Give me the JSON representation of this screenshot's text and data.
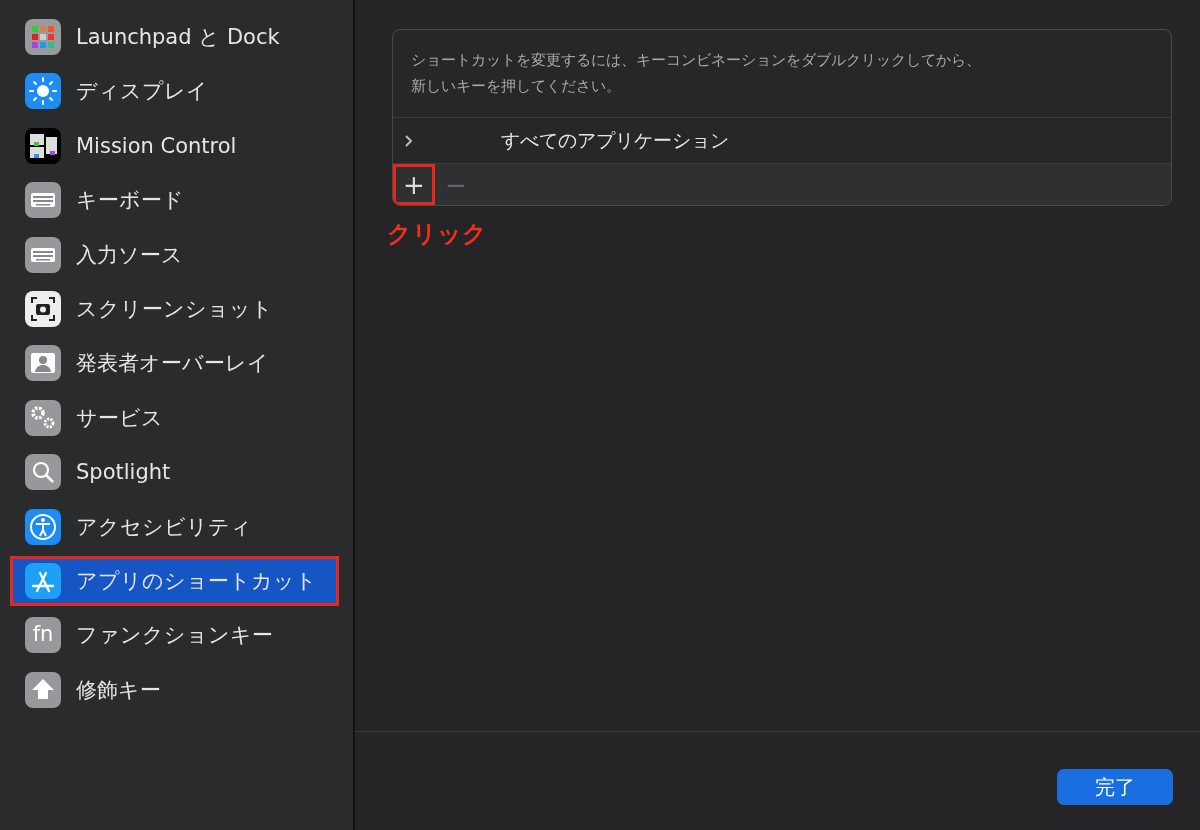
{
  "sidebar": {
    "items": [
      {
        "label": "Launchpad と Dock",
        "kind": "launchpad",
        "selected": false,
        "annotated": false
      },
      {
        "label": "ディスプレイ",
        "kind": "display",
        "selected": false,
        "annotated": false
      },
      {
        "label": "Mission Control",
        "kind": "mission",
        "selected": false,
        "annotated": false
      },
      {
        "label": "キーボード",
        "kind": "keyboard",
        "selected": false,
        "annotated": false
      },
      {
        "label": "入力ソース",
        "kind": "keyboard",
        "selected": false,
        "annotated": false
      },
      {
        "label": "スクリーンショット",
        "kind": "screenshot",
        "selected": false,
        "annotated": false
      },
      {
        "label": "発表者オーバーレイ",
        "kind": "person",
        "selected": false,
        "annotated": false
      },
      {
        "label": "サービス",
        "kind": "gears",
        "selected": false,
        "annotated": false
      },
      {
        "label": "Spotlight",
        "kind": "search",
        "selected": false,
        "annotated": false
      },
      {
        "label": "アクセシビリティ",
        "kind": "accessibility",
        "selected": false,
        "annotated": false
      },
      {
        "label": "アプリのショートカット",
        "kind": "appstore",
        "selected": true,
        "annotated": true
      },
      {
        "label": "ファンクションキー",
        "kind": "fn",
        "icon_text": "fn",
        "selected": false,
        "annotated": false
      },
      {
        "label": "修飾キー",
        "kind": "arrow",
        "selected": false,
        "annotated": false
      }
    ]
  },
  "panel": {
    "description": "ショートカットを変更するには、キーコンビネーションをダブルクリックしてから、新しいキーを押してください。",
    "rows": [
      {
        "label": "すべてのアプリケーション",
        "expanded": false
      }
    ],
    "add_button": {
      "label": "+",
      "annotated": true
    },
    "remove_button": {
      "label": "−",
      "disabled": true
    }
  },
  "callout": "クリック",
  "done_button": "完了"
}
